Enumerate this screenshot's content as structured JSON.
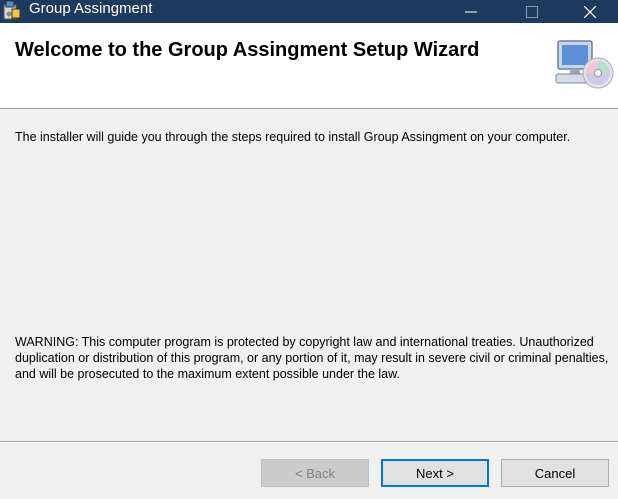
{
  "window": {
    "title": "Group Assingment",
    "controls": {
      "minimize": "minimize-icon",
      "maximize": "maximize-icon",
      "close": "close-icon"
    }
  },
  "header": {
    "title": "Welcome to the Group Assingment Setup Wizard",
    "icon": "computer-cd-icon"
  },
  "content": {
    "intro": "The installer will guide you through the steps required to install Group Assingment on your computer.",
    "warning": "WARNING: This computer program is protected by copyright law and international treaties. Unauthorized duplication or distribution of this program, or any portion of it, may result in severe civil or criminal penalties, and will be prosecuted to the maximum extent possible under the law."
  },
  "buttons": {
    "back": "< Back",
    "next": "Next >",
    "cancel": "Cancel"
  },
  "colors": {
    "titlebar": "#1e3a5c",
    "focus_border": "#0078d7"
  }
}
